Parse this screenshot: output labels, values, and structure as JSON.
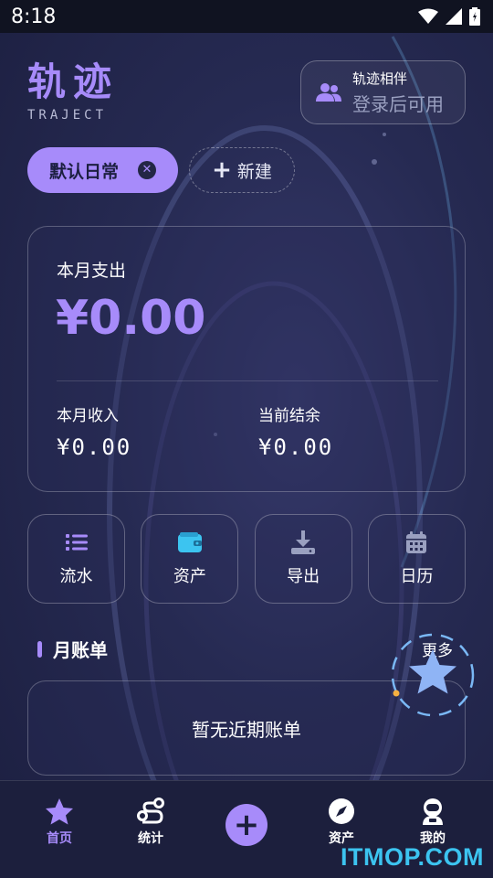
{
  "status_bar": {
    "time": "8:18"
  },
  "header": {
    "title": "轨迹",
    "subtitle": "TRAJECT",
    "companion": {
      "title": "轨迹相伴",
      "subtitle": "登录后可用"
    }
  },
  "ledgers": {
    "active_label": "默认日常",
    "new_label": "新建"
  },
  "summary": {
    "expense_label": "本月支出",
    "expense_value": "¥0.00",
    "income_label": "本月收入",
    "income_value": "¥0.00",
    "balance_label": "当前结余",
    "balance_value": "¥0.00"
  },
  "actions": [
    {
      "label": "流水",
      "icon": "list-icon"
    },
    {
      "label": "资产",
      "icon": "wallet-icon"
    },
    {
      "label": "导出",
      "icon": "download-icon"
    },
    {
      "label": "日历",
      "icon": "calendar-icon"
    }
  ],
  "bills": {
    "title": "月账单",
    "more_label": "更多",
    "empty_text": "暂无近期账单"
  },
  "bottom_nav": [
    {
      "label": "首页",
      "icon": "star-icon",
      "active": true
    },
    {
      "label": "统计",
      "icon": "route-icon",
      "active": false
    },
    {
      "label": "",
      "icon": "add-icon",
      "active": false
    },
    {
      "label": "资产",
      "icon": "compass-icon",
      "active": false
    },
    {
      "label": "我的",
      "icon": "astronaut-icon",
      "active": false
    }
  ],
  "watermark": "ITMOP.COM",
  "colors": {
    "accent": "#a78bfa",
    "background": "#262a52",
    "watermark": "#3cc4f0"
  }
}
